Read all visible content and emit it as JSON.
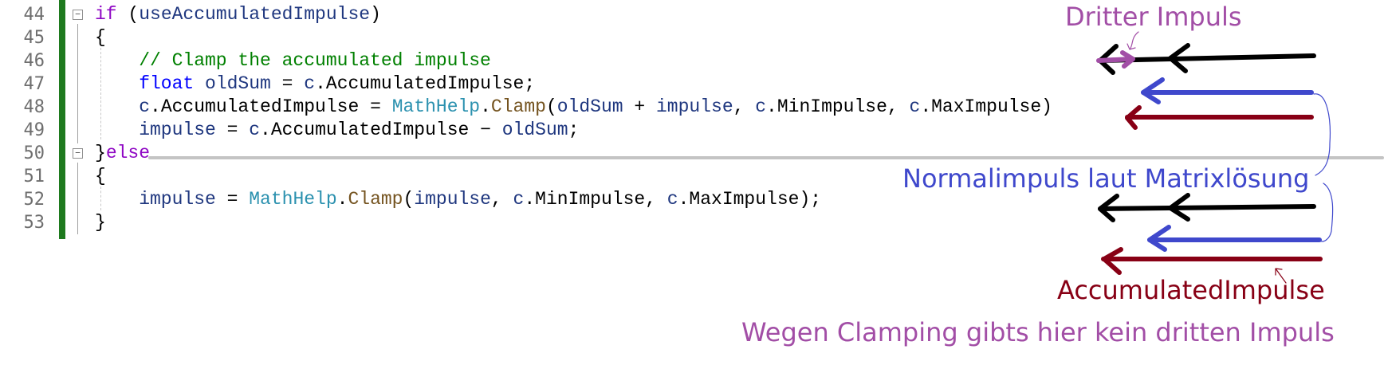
{
  "editor": {
    "lines": [
      {
        "num": "44",
        "indent": 0,
        "fold": "−",
        "tokens": [
          [
            "if",
            "kw"
          ],
          [
            " (",
            "pl"
          ],
          [
            "useAccumulatedImpulse",
            "id"
          ],
          [
            ")",
            "pl"
          ]
        ]
      },
      {
        "num": "45",
        "indent": 0,
        "tokens": [
          [
            "{",
            "pl"
          ]
        ]
      },
      {
        "num": "46",
        "indent": 4,
        "tokens": [
          [
            "// Clamp the accumulated impulse",
            "cm"
          ]
        ]
      },
      {
        "num": "47",
        "indent": 4,
        "tokens": [
          [
            "float",
            "ty"
          ],
          [
            " ",
            "pl"
          ],
          [
            "oldSum",
            "id"
          ],
          [
            " = ",
            "pl"
          ],
          [
            "c",
            "id"
          ],
          [
            ".",
            "pl"
          ],
          [
            "AccumulatedImpulse",
            "pl"
          ],
          [
            ";",
            "pl"
          ]
        ]
      },
      {
        "num": "48",
        "indent": 4,
        "tokens": [
          [
            "c",
            "id"
          ],
          [
            ".",
            "pl"
          ],
          [
            "AccumulatedImpulse",
            "pl"
          ],
          [
            " = ",
            "pl"
          ],
          [
            "MathHelp",
            "cls"
          ],
          [
            ".",
            "pl"
          ],
          [
            "Clamp",
            "mt"
          ],
          [
            "(",
            "pl"
          ],
          [
            "oldSum",
            "id"
          ],
          [
            " + ",
            "pl"
          ],
          [
            "impulse",
            "id"
          ],
          [
            ", ",
            "pl"
          ],
          [
            "c",
            "id"
          ],
          [
            ".",
            "pl"
          ],
          [
            "MinImpulse",
            "pl"
          ],
          [
            ", ",
            "pl"
          ],
          [
            "c",
            "id"
          ],
          [
            ".",
            "pl"
          ],
          [
            "MaxImpulse",
            "pl"
          ],
          [
            ")",
            "pl"
          ]
        ]
      },
      {
        "num": "49",
        "indent": 4,
        "tokens": [
          [
            "impulse",
            "id"
          ],
          [
            " = ",
            "pl"
          ],
          [
            "c",
            "id"
          ],
          [
            ".",
            "pl"
          ],
          [
            "AccumulatedImpulse",
            "pl"
          ],
          [
            " − ",
            "pl"
          ],
          [
            "oldSum",
            "id"
          ],
          [
            ";",
            "pl"
          ]
        ]
      },
      {
        "num": "50",
        "indent": 0,
        "fold": "−",
        "tokens": [
          [
            "}",
            "pl"
          ],
          [
            "else",
            "kw"
          ]
        ]
      },
      {
        "num": "51",
        "indent": 0,
        "tokens": [
          [
            "{",
            "pl"
          ]
        ]
      },
      {
        "num": "52",
        "indent": 4,
        "tokens": [
          [
            "impulse",
            "id"
          ],
          [
            " = ",
            "pl"
          ],
          [
            "MathHelp",
            "cls"
          ],
          [
            ".",
            "pl"
          ],
          [
            "Clamp",
            "mt"
          ],
          [
            "(",
            "pl"
          ],
          [
            "impulse",
            "id"
          ],
          [
            ", ",
            "pl"
          ],
          [
            "c",
            "id"
          ],
          [
            ".",
            "pl"
          ],
          [
            "MinImpulse",
            "pl"
          ],
          [
            ", ",
            "pl"
          ],
          [
            "c",
            "id"
          ],
          [
            ".",
            "pl"
          ],
          [
            "MaxImpulse",
            "pl"
          ],
          [
            ");",
            "pl"
          ]
        ]
      },
      {
        "num": "53",
        "indent": 0,
        "tokens": [
          [
            "}",
            "pl"
          ]
        ]
      }
    ]
  },
  "annotations": {
    "third_impulse": "Dritter Impuls",
    "normal_impulse": "Normalimpuls laut Matrixlösung",
    "accumulated": "AccumulatedImpulse",
    "no_third": "Wegen Clamping gibts hier kein dritten Impuls"
  },
  "colors": {
    "purple": "#a24ea6",
    "blue": "#3f48cc",
    "darkred": "#880015",
    "black": "#000000",
    "changebar": "#1e7a1e"
  }
}
